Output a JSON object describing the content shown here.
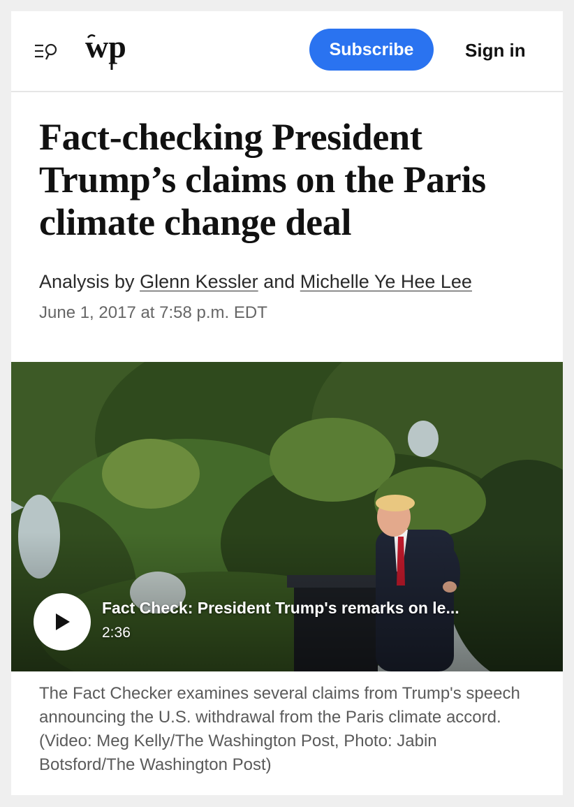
{
  "header": {
    "menu_icon": "menu-search-icon",
    "logo_icon": "wp-logo-icon",
    "subscribe_label": "Subscribe",
    "signin_label": "Sign in",
    "accent_color": "#2a73f0"
  },
  "article": {
    "headline": "Fact-checking President Trump’s claims on the Paris climate change deal",
    "byline_prefix": "Analysis by",
    "author_1": "Glenn Kessler",
    "byline_join": "and",
    "author_2": "Michelle Ye Hee Lee",
    "date": "June 1, 2017 at 7:58 p.m. EDT"
  },
  "video": {
    "title": "Fact Check: President Trump's remarks on le...",
    "duration": "2:36",
    "play_icon": "play-icon"
  },
  "caption": "The Fact Checker examines several claims from Trump's speech announcing the U.S. withdrawal from the Paris climate accord. (Video: Meg Kelly/The Washington Post, Photo: Jabin Botsford/The Washington Post)"
}
